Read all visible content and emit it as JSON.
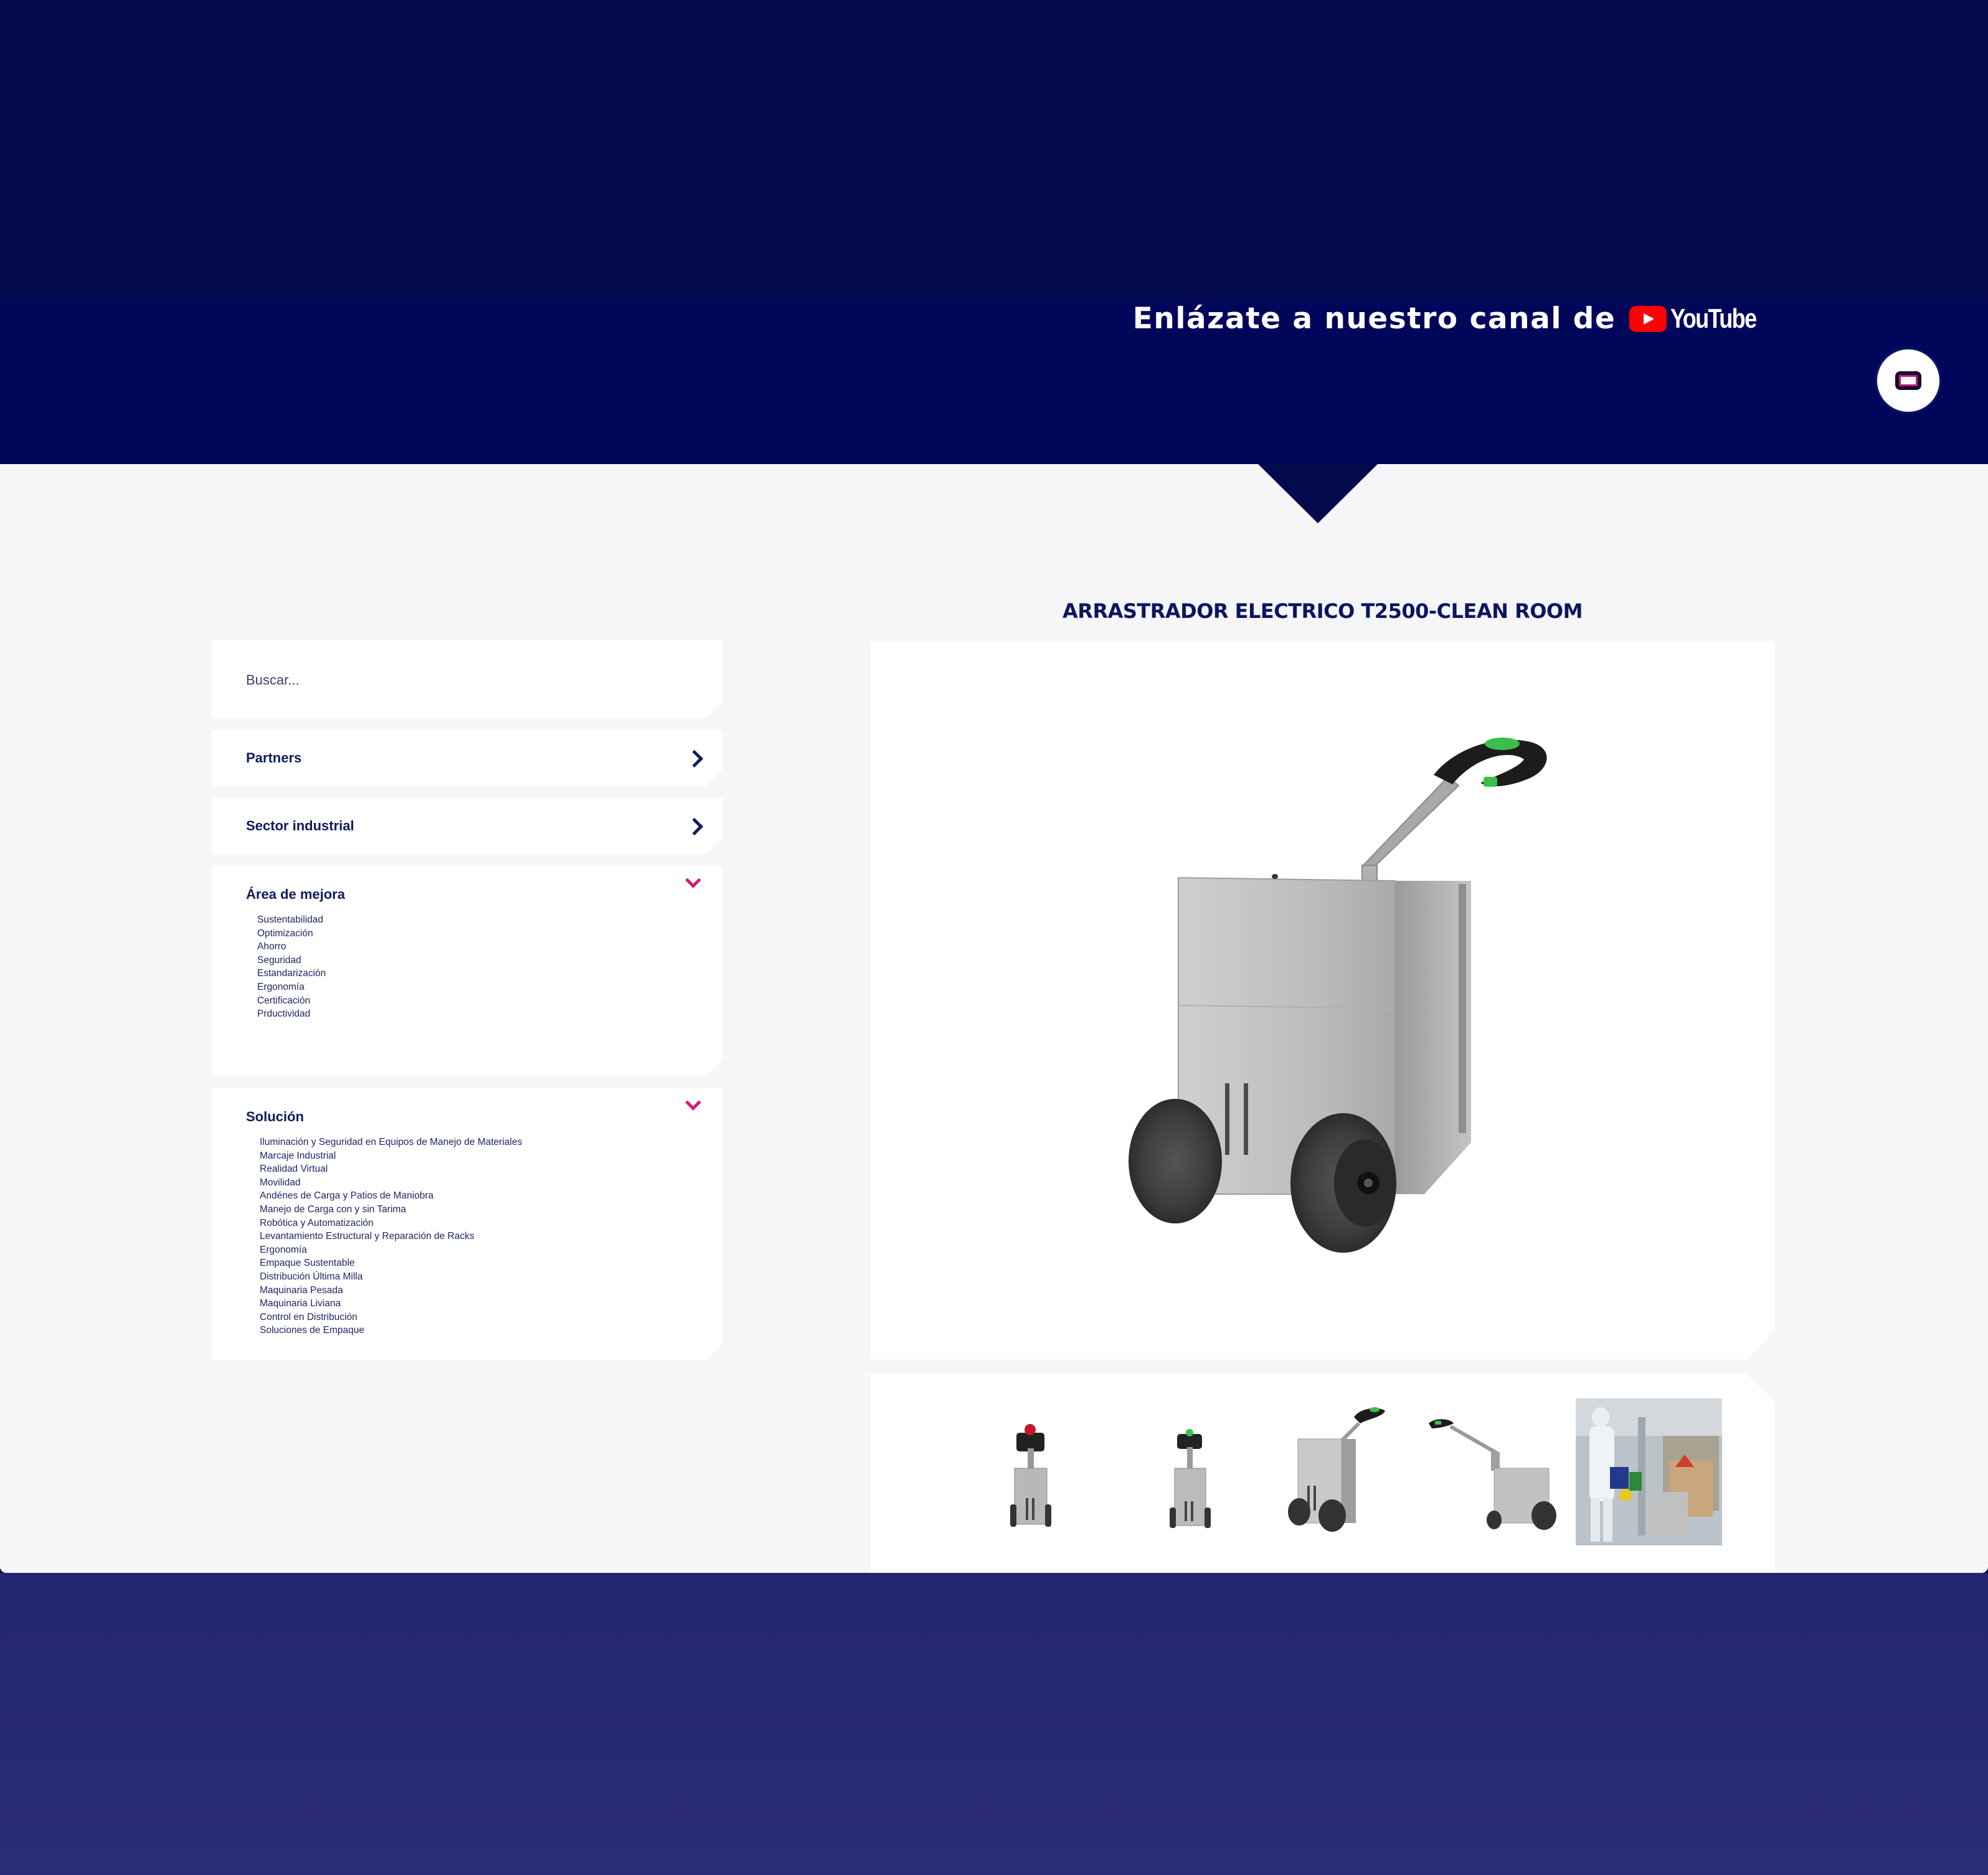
{
  "youtube_banner": {
    "text": "Enlázate a nuestro canal de",
    "logo_word": "YouTube"
  },
  "search": {
    "placeholder": "Buscar..."
  },
  "filters": {
    "partners": {
      "label": "Partners"
    },
    "sector": {
      "label": "Sector industrial"
    },
    "area": {
      "label": "Área de mejora",
      "options": [
        "Sustentabilidad",
        "Optimización",
        "Ahorro",
        "Seguridad",
        "Estandarización",
        "Ergonomía",
        "Certificación",
        "Prductividad"
      ]
    },
    "solucion": {
      "label": "Solución",
      "options": [
        "Iluminación y Seguridad en Equipos de Manejo de Materiales",
        "Marcaje Industrial",
        "Realidad Virtual",
        "Movilidad",
        "Andénes de Carga y Patios de Maniobra",
        "Manejo de Carga con y sin Tarima",
        "Robótica y Automatización",
        "Levantamiento Estructural y Reparación de Racks",
        "Ergonomía",
        "Empaque Sustentable",
        "Distribución Última Milla",
        "Maquinaria Pesada",
        "Maquinaria Liviana",
        "Control en Distribución",
        "Soluciones de Empaque"
      ]
    }
  },
  "product": {
    "title": "ARRASTRADOR ELECTRICO T2500-CLEAN ROOM",
    "thumbnails": [
      "front-view",
      "front-view-narrow",
      "three-quarter-view",
      "side-view",
      "in-use-clean-room-photo"
    ]
  },
  "colors": {
    "header_bg": "#02094d",
    "accent_pink": "#d21a77",
    "text_navy": "#101b5e",
    "footer_bg": "#282978"
  }
}
